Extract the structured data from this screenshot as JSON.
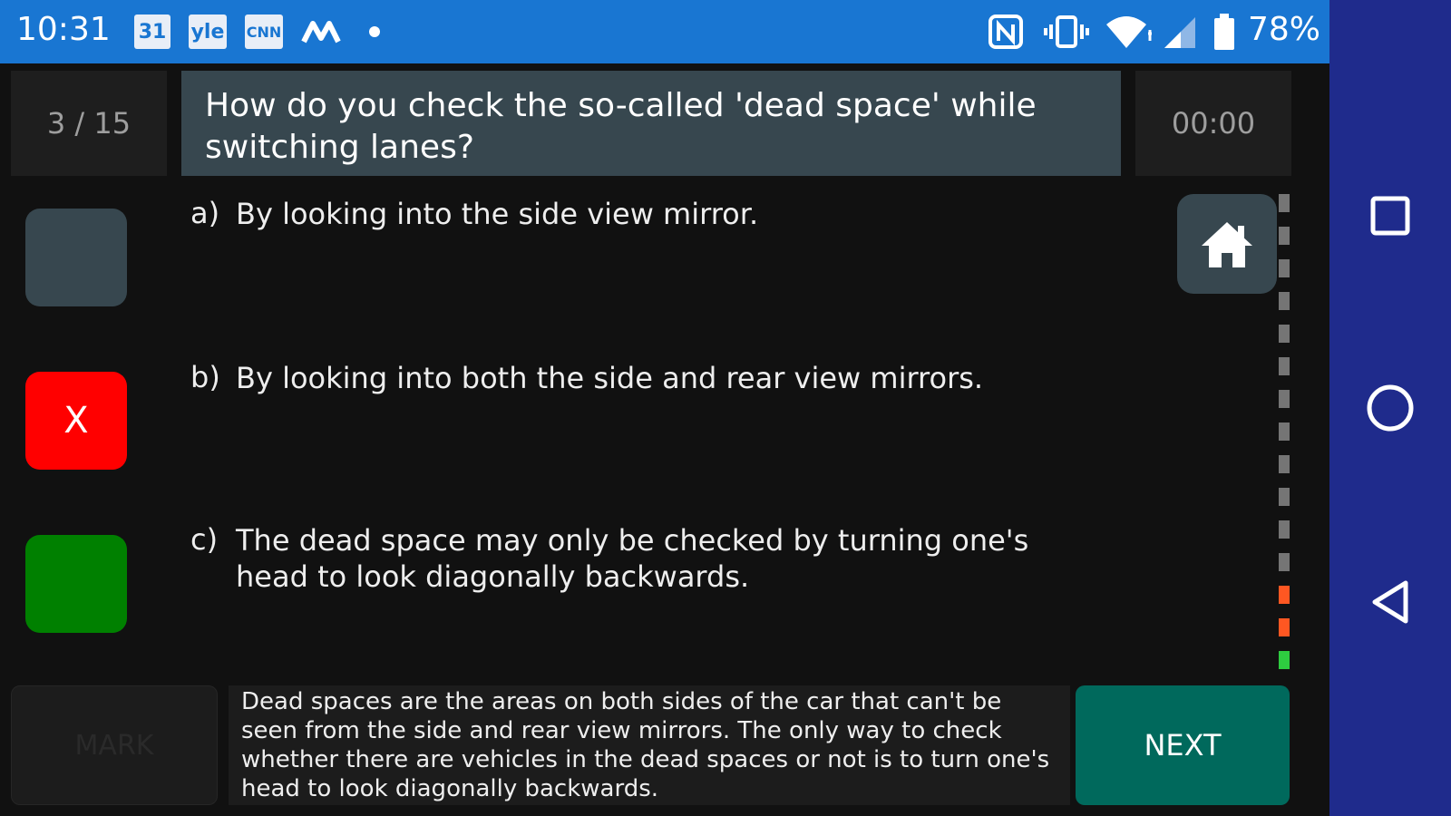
{
  "status_bar": {
    "time": "10:31",
    "battery_text": "78%",
    "app_icons": [
      "calendar-icon",
      "yle-icon",
      "cnn-icon",
      "m-app-icon",
      "notification-dot"
    ],
    "right_icons": [
      "nfc-icon",
      "vibrate-icon",
      "wifi-icon",
      "signal-icon",
      "battery-icon"
    ],
    "calendar_label": "31",
    "yle_label": "yle",
    "cnn_label": "CNN",
    "color": "#1976d2"
  },
  "quiz": {
    "counter": "3 / 15",
    "question": "How do you check the so-called 'dead space' while switching lanes?",
    "timer": "00:00",
    "answers": [
      {
        "letter": "a)",
        "text": "By looking into the side view mirror.",
        "state": "unanswered",
        "mark": "",
        "color": "#37474f"
      },
      {
        "letter": "b)",
        "text": "By looking into both the side and rear view mirrors.",
        "state": "wrong",
        "mark": "X",
        "color": "#ff0000"
      },
      {
        "letter": "c)",
        "text": "The dead space may only be checked by turning one's head to look diagonally backwards.",
        "state": "correct",
        "mark": "",
        "color": "#008000"
      }
    ],
    "mark_label": "MARK",
    "explanation": "Dead spaces are the areas on both sides of the car that can't be seen from the side and rear view mirrors. The only way to check whether there are vehicles in the dead spaces or not is to turn one's head to look diagonally backwards.",
    "next_label": "NEXT",
    "progress": [
      "grey",
      "grey",
      "grey",
      "grey",
      "grey",
      "grey",
      "grey",
      "grey",
      "grey",
      "grey",
      "grey",
      "grey",
      "orange",
      "orange",
      "green"
    ]
  },
  "colors": {
    "progress_grey": "#757575",
    "progress_orange": "#ff5722",
    "progress_green": "#2ecc40",
    "next_button": "#00695c",
    "question_bg": "#37474f"
  }
}
